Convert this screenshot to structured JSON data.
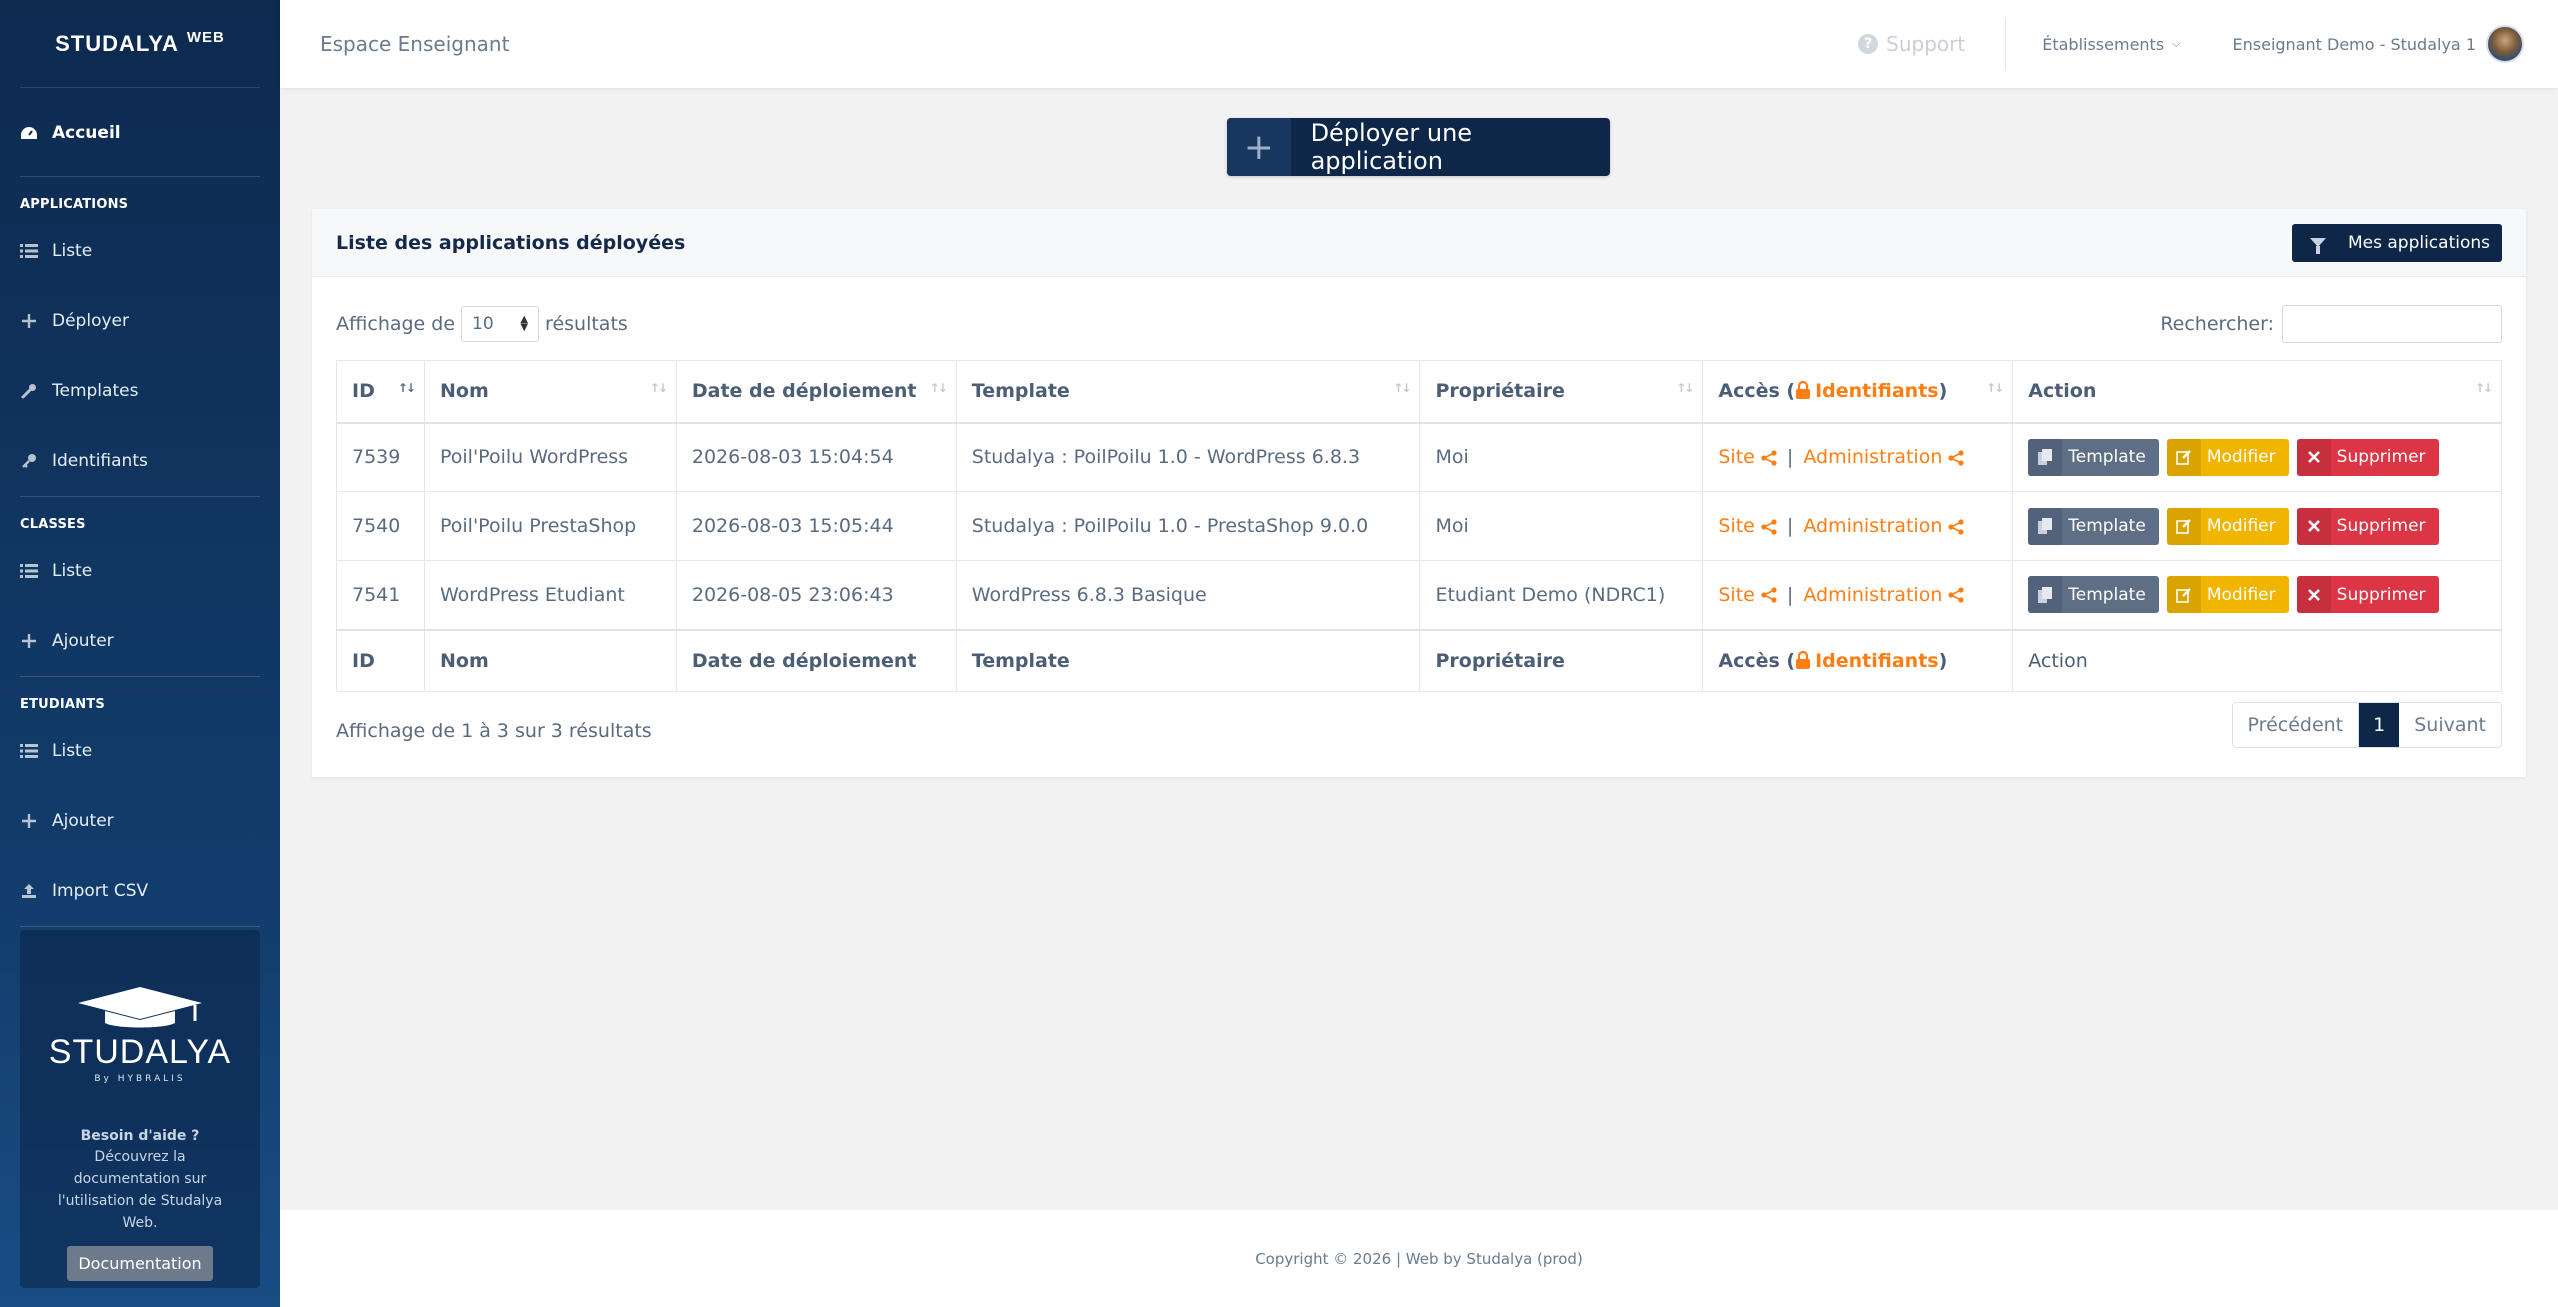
{
  "sidebar": {
    "brand": "STUDALYA",
    "brand_sup": "WEB",
    "home": "Accueil",
    "sections": [
      {
        "heading": "APPLICATIONS",
        "items": [
          "Liste",
          "Déployer",
          "Templates",
          "Identifiants"
        ]
      },
      {
        "heading": "CLASSES",
        "items": [
          "Liste",
          "Ajouter"
        ]
      },
      {
        "heading": "ETUDIANTS",
        "items": [
          "Liste",
          "Ajouter",
          "Import CSV"
        ]
      }
    ],
    "help": {
      "logo": "STUDALYA",
      "logo_sub": "By HYBRALIS",
      "title": "Besoin d'aide ?",
      "text": "Découvrez la documentation sur l'utilisation de Studalya Web.",
      "button": "Documentation"
    }
  },
  "topbar": {
    "title": "Espace Enseignant",
    "support": "Support",
    "establishments": "Établissements",
    "user": "Enseignant Demo - Studalya 1"
  },
  "deploy_button": "Déployer une application",
  "card": {
    "title": "Liste des applications déployées",
    "filter_button": "Mes applications",
    "length_prefix": "Affichage de",
    "length_value": "10",
    "length_suffix": "résultats",
    "search_label": "Rechercher:",
    "columns": {
      "id": "ID",
      "name": "Nom",
      "date": "Date de déploiement",
      "template": "Template",
      "owner": "Propriétaire",
      "access_prefix": "Accès (",
      "access_link": "Identifiants",
      "access_suffix": ")",
      "action": "Action"
    },
    "rows": [
      {
        "id": "7539",
        "name": "Poil'Poilu WordPress",
        "date": "2026-08-03 15:04:54",
        "template": "Studalya : PoilPoilu 1.0 - WordPress 6.8.3",
        "owner": "Moi"
      },
      {
        "id": "7540",
        "name": "Poil'Poilu PrestaShop",
        "date": "2026-08-03 15:05:44",
        "template": "Studalya : PoilPoilu 1.0 - PrestaShop 9.0.0",
        "owner": "Moi"
      },
      {
        "id": "7541",
        "name": "WordPress Etudiant",
        "date": "2026-08-05 23:06:43",
        "template": "WordPress 6.8.3 Basique",
        "owner": "Etudiant Demo (NDRC1)"
      }
    ],
    "access_site": "Site",
    "access_sep": "|",
    "access_admin": "Administration",
    "btn_template": "Template",
    "btn_edit": "Modifier",
    "btn_delete": "Supprimer",
    "info": "Affichage de 1 à 3 sur 3 résultats",
    "pager": {
      "prev": "Précédent",
      "current": "1",
      "next": "Suivant"
    }
  },
  "footer": "Copyright © 2026 | Web by Studalya (prod)"
}
